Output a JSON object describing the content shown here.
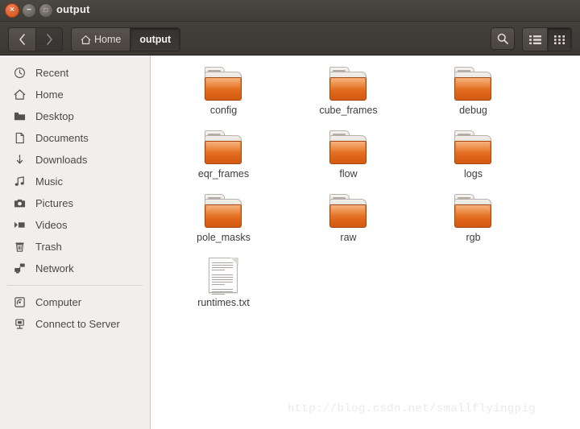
{
  "window": {
    "title": "output",
    "controls": [
      {
        "name": "close",
        "glyph": "×"
      },
      {
        "name": "minimize",
        "glyph": "−"
      },
      {
        "name": "maximize",
        "glyph": "□"
      }
    ]
  },
  "toolbar": {
    "back_label": "‹",
    "forward_label": "›",
    "breadcrumbs": [
      {
        "label": "Home",
        "icon": "home-icon",
        "active": false
      },
      {
        "label": "output",
        "icon": "",
        "active": true
      }
    ],
    "search_icon": "search-icon",
    "list_view_icon": "list-view-icon",
    "grid_view_icon": "grid-view-icon"
  },
  "sidebar": {
    "items": [
      {
        "label": "Recent",
        "icon": "clock-icon"
      },
      {
        "label": "Home",
        "icon": "home-icon"
      },
      {
        "label": "Desktop",
        "icon": "folder-icon"
      },
      {
        "label": "Documents",
        "icon": "document-icon"
      },
      {
        "label": "Downloads",
        "icon": "download-arrow-icon"
      },
      {
        "label": "Music",
        "icon": "music-note-icon"
      },
      {
        "label": "Pictures",
        "icon": "camera-icon"
      },
      {
        "label": "Videos",
        "icon": "video-icon"
      },
      {
        "label": "Trash",
        "icon": "trash-icon"
      },
      {
        "label": "Network",
        "icon": "network-icon"
      }
    ],
    "items2": [
      {
        "label": "Computer",
        "icon": "computer-icon"
      },
      {
        "label": "Connect to Server",
        "icon": "connect-server-icon"
      }
    ]
  },
  "files": [
    {
      "name": "config",
      "type": "folder"
    },
    {
      "name": "cube_frames",
      "type": "folder"
    },
    {
      "name": "debug",
      "type": "folder"
    },
    {
      "name": "eqr_frames",
      "type": "folder"
    },
    {
      "name": "flow",
      "type": "folder"
    },
    {
      "name": "logs",
      "type": "folder"
    },
    {
      "name": "pole_masks",
      "type": "folder"
    },
    {
      "name": "raw",
      "type": "folder"
    },
    {
      "name": "rgb",
      "type": "folder"
    },
    {
      "name": "runtimes.txt",
      "type": "text"
    }
  ],
  "watermark": "http://blog.csdn.net/smallflyingpig",
  "colors": {
    "folder_orange": "#e0701f",
    "titlebar": "#413d39",
    "sidebar_bg": "#f1efed"
  }
}
